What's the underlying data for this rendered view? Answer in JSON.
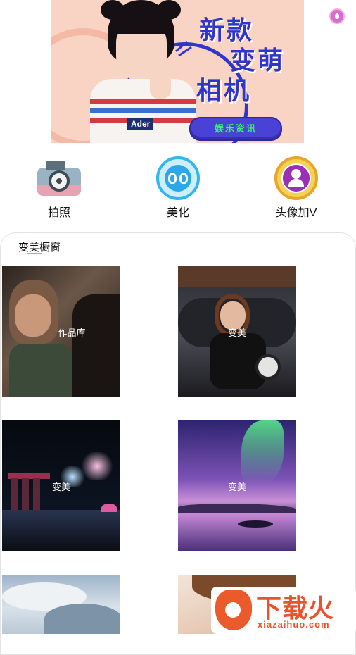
{
  "banner": {
    "slogan_line1": "新款",
    "slogan_line2": "变萌",
    "slogan_line3": "相机",
    "shirt_tag": "Ader",
    "cta_label": "娱乐资讯"
  },
  "features": [
    {
      "label": "拍照",
      "icon": "camera-icon"
    },
    {
      "label": "美化",
      "icon": "beauty-icon"
    },
    {
      "label": "头像加V",
      "icon": "avatar-v-icon"
    }
  ],
  "showcase": {
    "title": "变美橱窗",
    "tiles": [
      {
        "caption": "作品库"
      },
      {
        "caption": "变美"
      },
      {
        "caption": "变美"
      },
      {
        "caption": "变美"
      },
      {
        "caption": ""
      },
      {
        "caption": ""
      }
    ]
  },
  "watermark": {
    "brand": "下载火",
    "url": "xiazaihuo.com"
  },
  "colors": {
    "accent_blue": "#2f36c9",
    "cta_text": "#3bf06a",
    "underline_pink": "#f28aa2",
    "watermark_orange": "#e9522a"
  }
}
